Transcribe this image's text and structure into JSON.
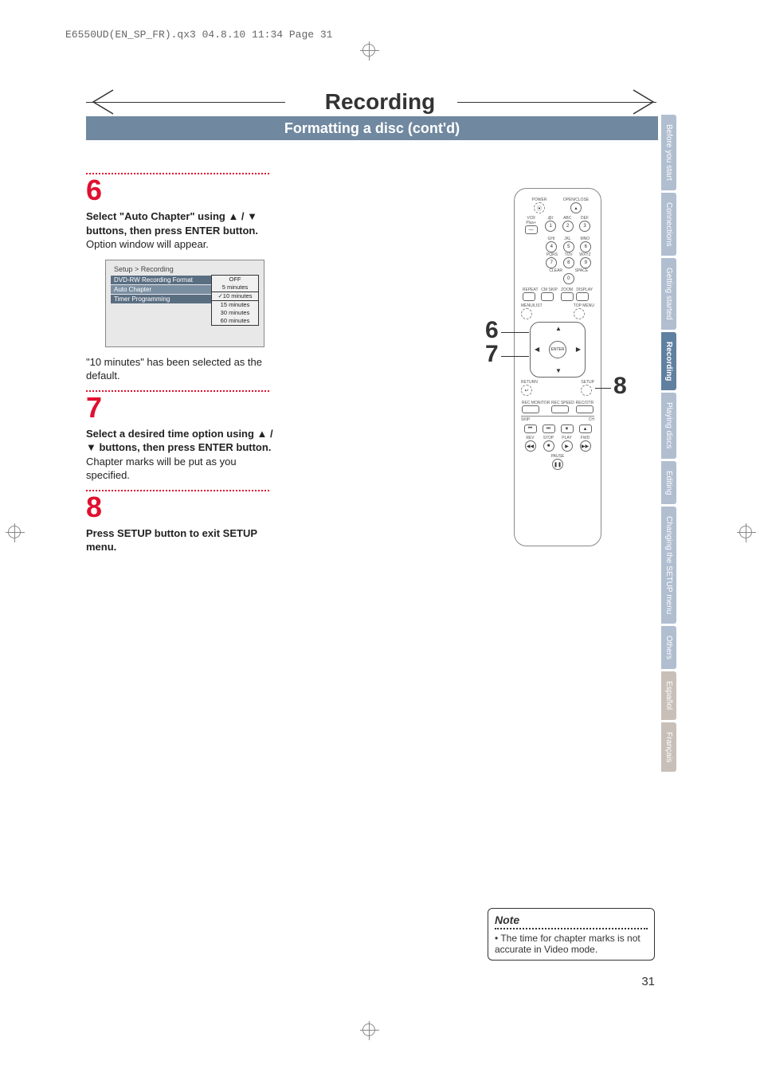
{
  "header": {
    "file_info": "E6550UD(EN_SP_FR).qx3  04.8.10  11:34  Page 31"
  },
  "title": {
    "main": "Recording",
    "sub": "Formatting a disc (cont'd)"
  },
  "steps": [
    {
      "num": "6",
      "bold": "Select \"Auto Chapter\" using ▲ / ▼ buttons, then press ENTER button.",
      "plain": "Option window will appear.",
      "after": "\"10 minutes\" has been selected as the default."
    },
    {
      "num": "7",
      "bold": "Select a desired time option using ▲ / ▼ buttons, then press ENTER button.",
      "plain": "Chapter marks will be put as you specified.",
      "after": ""
    },
    {
      "num": "8",
      "bold": "Press SETUP button to exit SETUP menu.",
      "plain": "",
      "after": ""
    }
  ],
  "menu": {
    "crumb": "Setup > Recording",
    "items": [
      "DVD-RW Recording Format",
      "Auto Chapter",
      "Timer Programming"
    ],
    "options": [
      "OFF",
      "5 minutes",
      "10 minutes",
      "15 minutes",
      "30 minutes",
      "60 minutes"
    ],
    "selected": "10 minutes"
  },
  "remote": {
    "labels_top": {
      "power": "POWER",
      "open": "OPEN/CLOSE"
    },
    "vcr": "VCR Plus+",
    "row1": [
      ".@/:",
      "ABC",
      "DEF"
    ],
    "nums1": [
      "1",
      "2",
      "3"
    ],
    "row2": [
      "GHI",
      "JKL",
      "MNO"
    ],
    "nums2": [
      "4",
      "5",
      "6"
    ],
    "row3": [
      "PQRS",
      "TUV",
      "WXYZ"
    ],
    "nums3": [
      "7",
      "8",
      "9"
    ],
    "row4": [
      "CLEAR",
      "SPACE"
    ],
    "nums4": [
      "0"
    ],
    "mid": {
      "repeat": "REPEAT",
      "cmskip": "CM SKIP",
      "zoom": "ZOOM",
      "display": "DISPLAY"
    },
    "menulist": "MENU/LIST",
    "topmenu": "TOP MENU",
    "enter": "ENTER",
    "return": "RETURN",
    "setup": "SETUP",
    "rec": {
      "monitor": "REC MONITOR",
      "speed": "REC SPEED",
      "otr": "REC/OTR"
    },
    "skip": "SKIP",
    "ch": "CH",
    "transport": {
      "rev": "REV",
      "stop": "STOP",
      "play": "PLAY",
      "fwd": "FWD",
      "pause": "PAUSE"
    }
  },
  "callouts": {
    "c6": "6",
    "c7": "7",
    "c8": "8"
  },
  "tabs": [
    "Before you start",
    "Connections",
    "Getting started",
    "Recording",
    "Playing discs",
    "Editing",
    "Changing the SETUP menu",
    "Others",
    "Español",
    "Français"
  ],
  "note": {
    "title": "Note",
    "body": "• The time for chapter marks is not accurate in Video mode."
  },
  "page_number": "31"
}
